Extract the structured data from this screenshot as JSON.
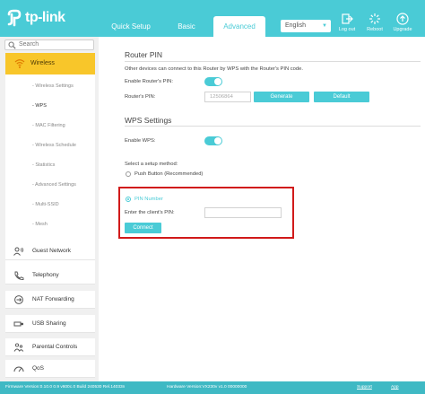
{
  "brand": {
    "name": "tp-link",
    "color": "#4acbd6"
  },
  "header": {
    "tabs": [
      {
        "label": "Quick Setup"
      },
      {
        "label": "Basic"
      },
      {
        "label": "Advanced"
      }
    ],
    "language": "English",
    "buttons": [
      {
        "label": "Log out",
        "icon": "logout-icon"
      },
      {
        "label": "Reboot",
        "icon": "reboot-icon"
      },
      {
        "label": "Upgrade",
        "icon": "upgrade-icon"
      }
    ]
  },
  "sidebar": {
    "search_placeholder": "Search",
    "active": {
      "label": "Wireless",
      "icon": "wifi-icon",
      "color": "#f8c62a"
    },
    "subitems": [
      {
        "label": "- Wireless Settings"
      },
      {
        "label": "- WPS"
      },
      {
        "label": "- MAC Filtering"
      },
      {
        "label": "- Wireless Schedule"
      },
      {
        "label": "- Statistics"
      },
      {
        "label": "- Advanced Settings"
      },
      {
        "label": "- Multi-SSID"
      },
      {
        "label": "- Mesh"
      }
    ],
    "items": [
      {
        "label": "Guest Network",
        "icon": "guest-network-icon"
      },
      {
        "label": "Telephony",
        "icon": "telephone-icon"
      },
      {
        "label": "NAT Forwarding",
        "icon": "nat-forwarding-icon"
      },
      {
        "label": "USB Sharing",
        "icon": "usb-icon"
      },
      {
        "label": "Parental Controls",
        "icon": "parental-controls-icon"
      },
      {
        "label": "QoS",
        "icon": "qos-icon"
      }
    ]
  },
  "router_pin": {
    "title": "Router PIN",
    "description": "Other devices can connect to this Router by WPS with the Router's PIN code.",
    "enable_label": "Enable Router's PIN:",
    "enabled": true,
    "pin_label": "Router's PIN:",
    "pin_value": "12506864",
    "generate_label": "Generate",
    "default_label": "Default"
  },
  "wps_settings": {
    "title": "WPS Settings",
    "enable_label": "Enable WPS:",
    "enabled": true,
    "method_label": "Select a setup method:",
    "push_button_label": "Push Button (Recommended)",
    "pin_number_label": "PIN Number",
    "client_pin_label": "Enter the client's PIN:",
    "client_pin_value": "",
    "connect_label": "Connect",
    "selected_method": "PIN Number"
  },
  "footer": {
    "firmware": "Firmware Version:0.10.0 0.9 v600c.0 Build 240530 Rel.14033n",
    "hardware": "Hardware Version:VX230v v1.0 00000000",
    "support": "Support",
    "app": "App"
  },
  "colors": {
    "highlight_border": "#d11a1a",
    "footer_bg": "#3fb9c4"
  }
}
